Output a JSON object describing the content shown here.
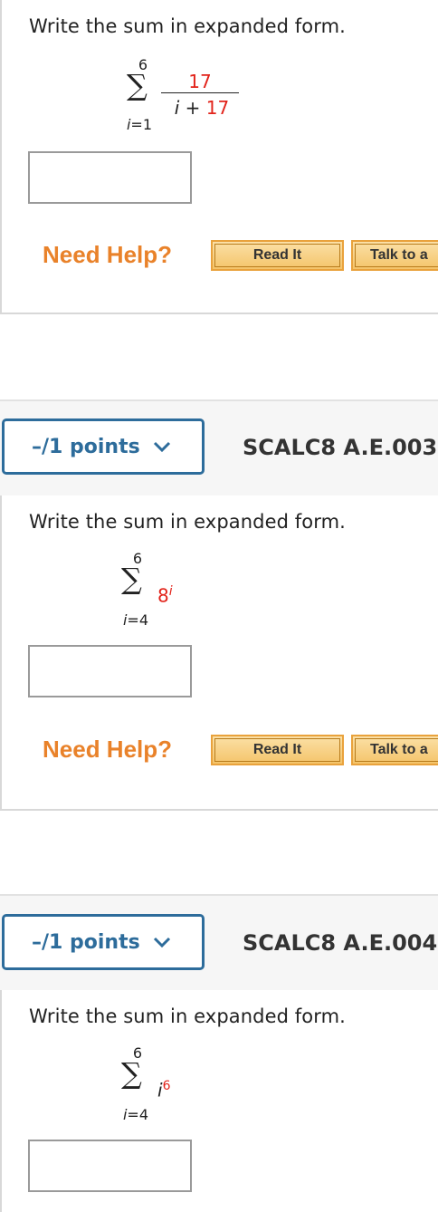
{
  "q1": {
    "prompt": "Write the sum in expanded form.",
    "upper": "6",
    "lower": "i=1",
    "numerator": "17",
    "denominator": "i + 17",
    "need_help": "Need Help?",
    "read_it": "Read It",
    "talk_to": "Talk to a"
  },
  "q2": {
    "points": "–/1 points",
    "code": "SCALC8 A.E.003.",
    "prompt": "Write the sum in expanded form.",
    "upper": "6",
    "lower": "i=4",
    "base": "8",
    "exponent": "i",
    "need_help": "Need Help?",
    "read_it": "Read It",
    "talk_to": "Talk to a"
  },
  "q3": {
    "points": "–/1 points",
    "code": "SCALC8 A.E.004.",
    "prompt": "Write the sum in expanded form.",
    "upper": "6",
    "lower": "i=4",
    "base": "i",
    "exponent": "6"
  },
  "colors": {
    "accent_blue": "#2d6c9b",
    "help_orange": "#e9822a",
    "math_red": "#e2231a"
  }
}
